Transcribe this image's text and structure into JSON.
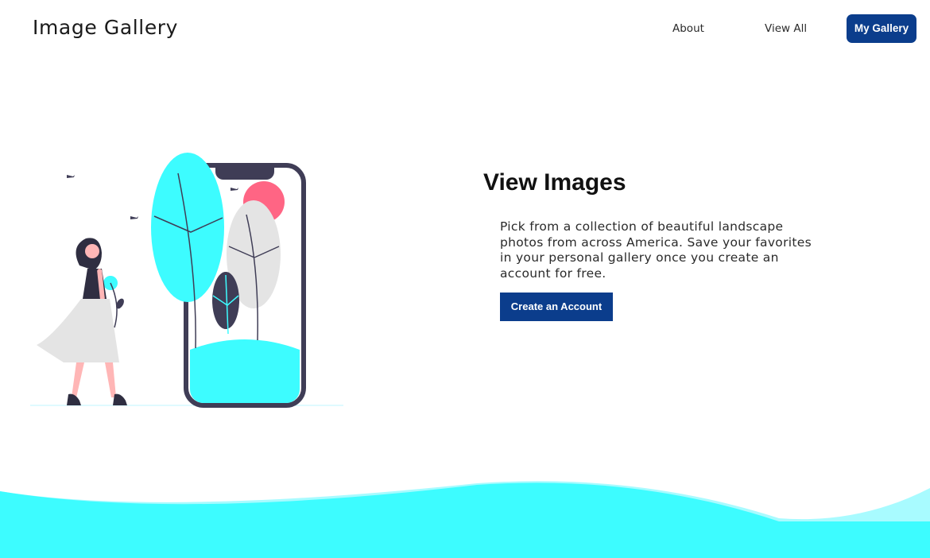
{
  "header": {
    "brand": "Image Gallery",
    "nav": {
      "about": "About",
      "view_all": "View All",
      "my_gallery": "My Gallery"
    }
  },
  "hero": {
    "title": "View Images",
    "description": "Pick from a collection of beautiful landscape photos from across America. Save your favorites in your personal gallery once you create an account for free.",
    "cta_label": "Create an Account"
  },
  "colors": {
    "primary": "#0b3d8c",
    "accent": "#3dfcff",
    "sun": "#ff6584",
    "dark": "#3f3d56"
  }
}
